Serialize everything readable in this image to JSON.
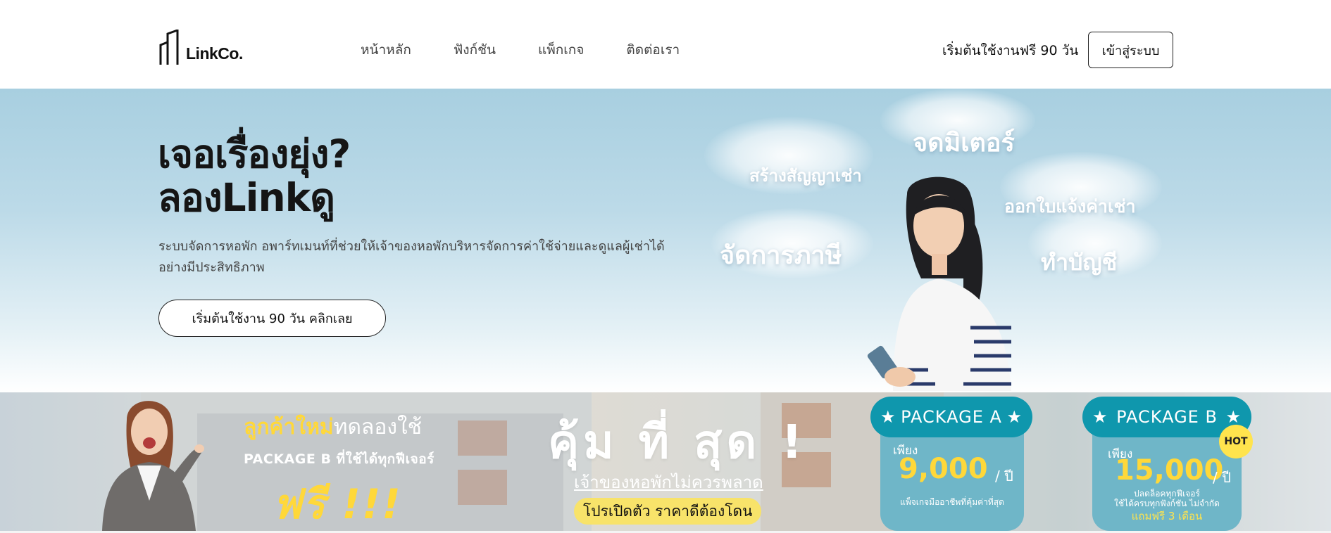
{
  "brand": {
    "name": "LinkCo."
  },
  "nav": {
    "menu": [
      {
        "label": "หน้าหลัก"
      },
      {
        "label": "ฟังก์ชัน"
      },
      {
        "label": "แพ็กเกจ"
      },
      {
        "label": "ติดต่อเรา"
      }
    ],
    "trial_link": "เริ่มต้นใช้งานฟรี 90 วัน",
    "login_label": "เข้าสู่ระบบ"
  },
  "hero": {
    "title_line1": "เจอเรื่องยุ่ง?",
    "title_line2_prefix": "ลอง",
    "title_line2_bold": "Link",
    "title_line2_suffix": "ดู",
    "description": "ระบบจัดการหอพัก อพาร์ทเมนท์ที่ช่วยให้เจ้าของหอพักบริหารจัดการค่าใช้จ่ายและดูแลผู้เช่าได้อย่างมีประสิทธิภาพ",
    "cta_label": "เริ่มต้นใช้งาน 90 วัน คลิกเลย",
    "cloud_words": [
      "จดมิเตอร์",
      "สร้างสัญญาเช่า",
      "ออกใบแจ้งค่าเช่า",
      "จัดการภาษี",
      "ทำบัญชี"
    ]
  },
  "banner": {
    "new_customer_highlight": "ลูกค้าใหม่",
    "new_customer_rest": "ทดลองใช้",
    "package_line": "PACKAGE B ที่ใช้ได้ทุกฟีเจอร์",
    "free_label": "ฟรี !!!",
    "headline": "คุ้ม ที่ สุด !",
    "owners_line": "เจ้าของหอพักไม่ควรพลาด",
    "promo_pill": "โปรเปิดตัว ราคาดีต้องโดน",
    "packages": [
      {
        "name": "PACKAGE A",
        "only": "เพียง",
        "price": "9,000",
        "unit": "/ ปี",
        "note": "แพ็จเกจมืออาชีพที่คุ้มค่าที่สุด"
      },
      {
        "name": "PACKAGE B",
        "only": "เพียง",
        "price": "15,000",
        "unit": "/ ปี",
        "note1": "ปลดล็อคทุกฟีเจอร์",
        "note2": "ใช้ได้ครบทุกฟังก์ชัน ไม่จำกัด",
        "bonus": "แถมฟรี 3 เดือน",
        "badge": "HOT"
      }
    ]
  },
  "colors": {
    "hero_top": "#a8cfe0",
    "package_head": "#0f97ad",
    "package_body": "#6fb6c8",
    "accent_yellow": "#ffd83a"
  }
}
